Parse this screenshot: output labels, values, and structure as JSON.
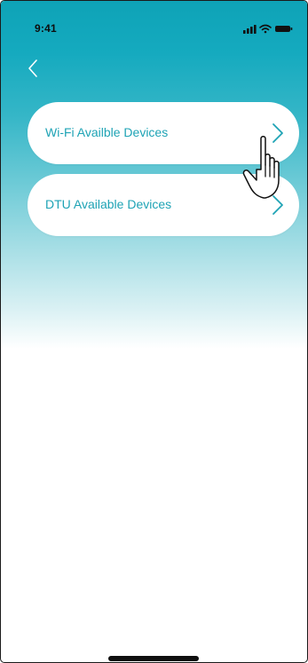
{
  "status_bar": {
    "time": "9:41"
  },
  "navigation": {
    "back_icon": "chevron-left-icon"
  },
  "device_list": {
    "items": [
      {
        "label": "Wi-Fi Availble Devices",
        "icon": "chevron-right-icon"
      },
      {
        "label": "DTU Available Devices",
        "icon": "chevron-right-icon"
      }
    ]
  },
  "colors": {
    "accent": "#1ea3b5",
    "gradient_top": "#0ea3b7",
    "card_background": "#ffffff"
  }
}
